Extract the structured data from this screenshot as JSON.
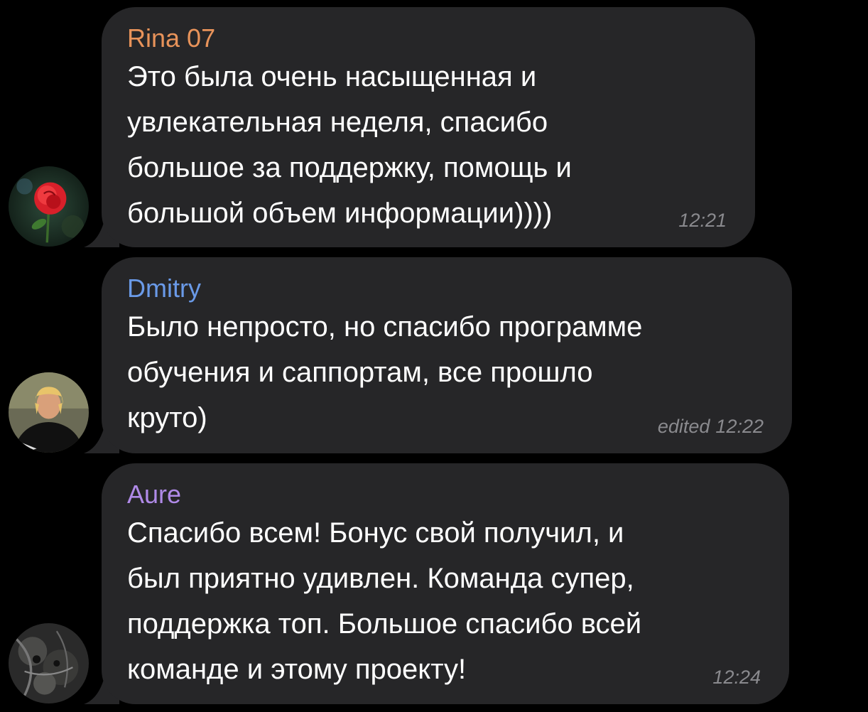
{
  "colors": {
    "background": "#000000",
    "bubble": "#262628",
    "time": "#8a8a8e",
    "rina": "#e8935a",
    "dmitry": "#6a9ae8",
    "aure": "#b08ae8"
  },
  "messages": [
    {
      "sender": "Rina 07",
      "text": "Это была очень насыщенная и\nувлекательная неделя, спасибо\nбольшое за поддержку, помощь и\nбольшой объем информации))))",
      "time": "12:21",
      "edited": "",
      "avatar": "rose-photo"
    },
    {
      "sender": "Dmitry",
      "text": "Было непросто, но спасибо программе\nобучения и саппортам, все прошло\nкруто)",
      "time": "12:22",
      "edited": "edited",
      "avatar": "person-photo"
    },
    {
      "sender": "Aure",
      "text": "Спасибо всем! Бонус свой получил, и\nбыл приятно удивлен. Команда супер,\nподдержка топ. Большое спасибо всей\nкоманде и этому проекту!",
      "time": "12:24",
      "edited": "",
      "avatar": "dark-abstract-photo"
    }
  ]
}
